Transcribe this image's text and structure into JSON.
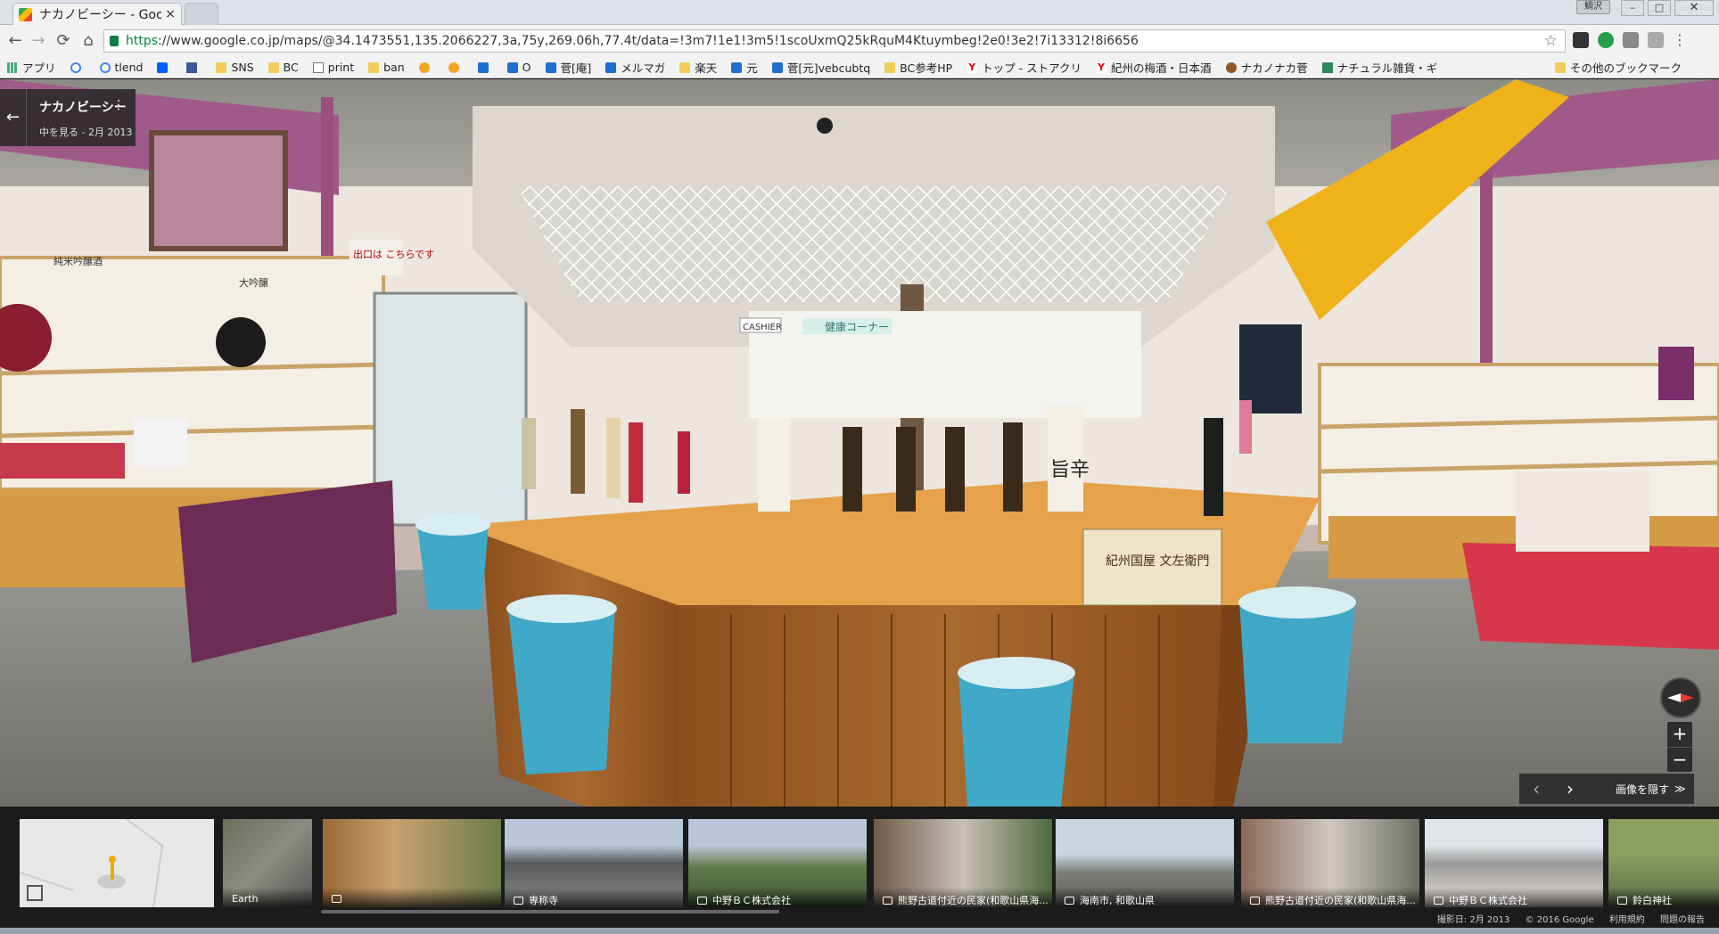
{
  "browser": {
    "tab_title": "ナカノビーシー - Googl",
    "tab_close": "×",
    "url_scheme": "https",
    "url_rest": "://www.google.co.jp/maps/@34.1473551,135.2066227,3a,75y,269.06h,77.4t/data=!3m7!1e1!3m5!1scoUxmQ25kRquM4Ktuymbeg!2e0!3e2!7i13312!8i6656",
    "nav_back": "←",
    "nav_forward": "→",
    "nav_reload": "⟳",
    "nav_home": "⌂",
    "star": "☆",
    "user_badge": "鯛沢"
  },
  "bookmarks": [
    {
      "label": "アプリ",
      "icon": "apps-icon"
    },
    {
      "label": "",
      "icon": "google-icon"
    },
    {
      "label": "tlend",
      "icon": "google-icon"
    },
    {
      "label": "",
      "icon": "dropbox-icon"
    },
    {
      "label": "",
      "icon": "facebook-icon"
    },
    {
      "label": "SNS",
      "icon": "folder-icon"
    },
    {
      "label": "BC",
      "icon": "folder-icon"
    },
    {
      "label": "print",
      "icon": "document-icon"
    },
    {
      "label": "ban",
      "icon": "folder-icon"
    },
    {
      "label": "",
      "icon": "orange-icon"
    },
    {
      "label": "",
      "icon": "orange-icon"
    },
    {
      "label": "",
      "icon": "n-icon"
    },
    {
      "label": "O",
      "icon": "n-icon"
    },
    {
      "label": "菅[庵]",
      "icon": "n-icon"
    },
    {
      "label": "メルマガ",
      "icon": "n-icon"
    },
    {
      "label": "楽天",
      "icon": "folder-icon"
    },
    {
      "label": "元",
      "icon": "n-icon"
    },
    {
      "label": "菅[元]vebcubtq",
      "icon": "n-icon"
    },
    {
      "label": "BC参考HP",
      "icon": "folder-icon"
    },
    {
      "label": "トップ - ストアクリ",
      "icon": "yahoo-icon"
    },
    {
      "label": "紀州の梅酒・日本酒",
      "icon": "yahoo-icon"
    },
    {
      "label": "ナカノナカ菅",
      "icon": "brown-icon"
    },
    {
      "label": "ナチュラル雑貨・ギ",
      "icon": "green-icon"
    }
  ],
  "bookmarks_other": "その他のブックマーク",
  "place_card": {
    "back": "←",
    "name": "ナカノビーシー",
    "subtitle": "中を見る - 2月 2013",
    "more": "⋮"
  },
  "scene_text": {
    "cashier_sign": "CASHIER",
    "health_corner": "健康コーナー",
    "exit_sign": "出口は こちらです",
    "label_tall_bottle": "旨辛",
    "shelf_label_1": "純米吟醸酒",
    "shelf_label_2": "大吟醸",
    "counter_poster": "紀州国屋 文左衛門"
  },
  "controls": {
    "zoom_in": "+",
    "zoom_out": "−",
    "prev": "‹",
    "next": "›",
    "hide_images": "画像を隠す",
    "hide_chevron": "≫"
  },
  "filmstrip": [
    {
      "caption": "",
      "kind": "minimap"
    },
    {
      "caption": "Earth",
      "kind": "earth"
    },
    {
      "caption": "",
      "kind": "panorama"
    },
    {
      "caption": "専称寺",
      "kind": "photo"
    },
    {
      "caption": "中野ＢＣ株式会社",
      "kind": "photo"
    },
    {
      "caption": "熊野古道付近の民家(和歌山県海...",
      "kind": "photo"
    },
    {
      "caption": "海南市, 和歌山県",
      "kind": "panorama"
    },
    {
      "caption": "熊野古道付近の民家(和歌山県海...",
      "kind": "photo"
    },
    {
      "caption": "中野ＢＣ株式会社",
      "kind": "panorama"
    },
    {
      "caption": "鈴白神社",
      "kind": "photo"
    }
  ],
  "footer": {
    "date": "撮影日: 2月 2013",
    "copyright": "© 2016 Google",
    "terms": "利用規約",
    "report": "問題の報告"
  },
  "colors": {
    "bucket": "#3fa9c7",
    "counter_top": "#e5a24a",
    "counter_wood": "#9a5a22",
    "wall_purple": "#a05a8a",
    "accent_yellow": "#f0b21a",
    "table_red": "#d7374a"
  }
}
